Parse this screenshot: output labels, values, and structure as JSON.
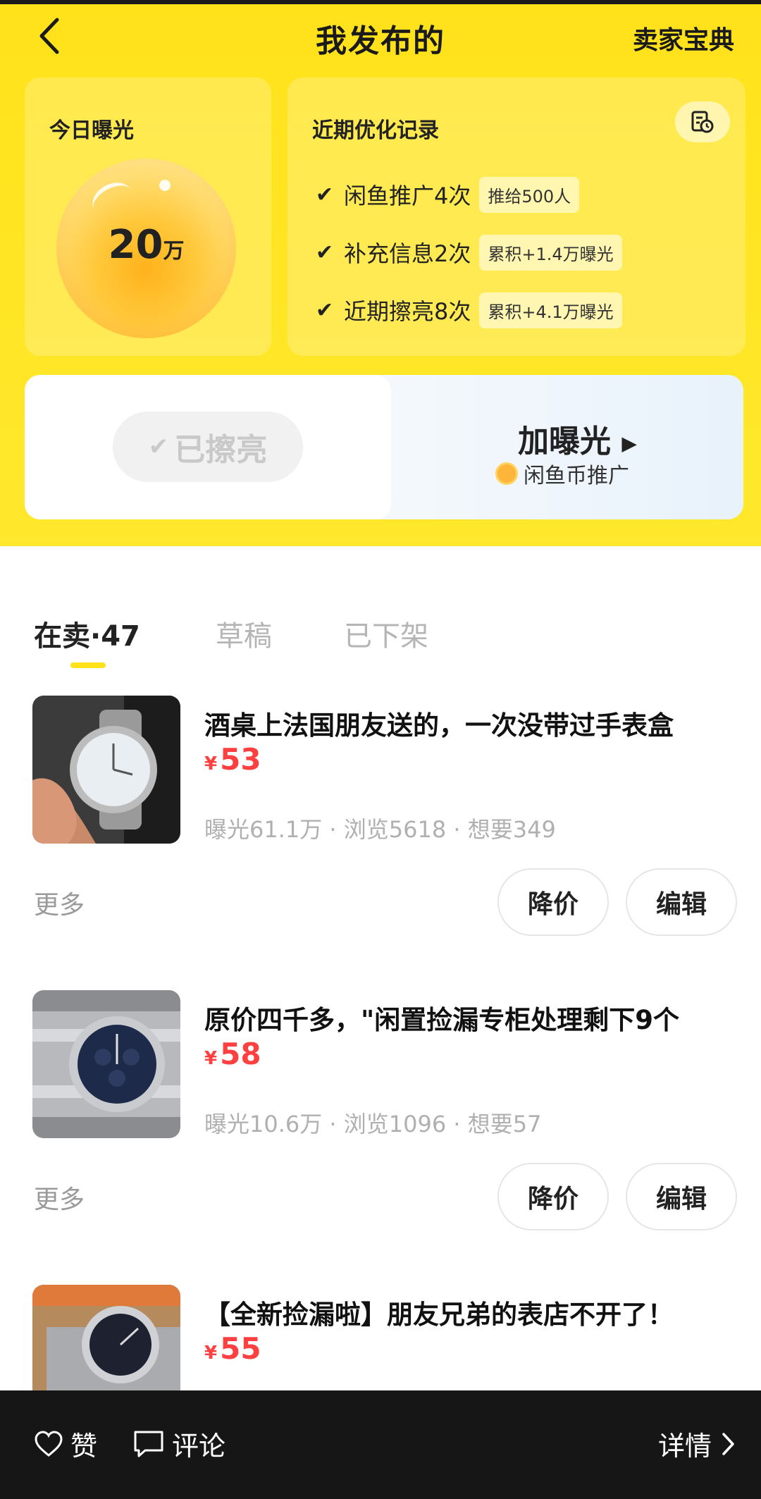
{
  "nav": {
    "title": "我发布的",
    "right_link": "卖家宝典"
  },
  "exposure": {
    "label": "今日曝光",
    "value": "20",
    "unit": "万"
  },
  "records": {
    "label": "近期优化记录",
    "items": [
      {
        "text": "闲鱼推广4次",
        "tag": "推给500人"
      },
      {
        "text": "补充信息2次",
        "tag": "累积+1.4万曝光"
      },
      {
        "text": "近期擦亮8次",
        "tag": "累积+4.1万曝光"
      }
    ]
  },
  "cta": {
    "polished_label": "已擦亮",
    "boost_title": "加曝光",
    "boost_sub": "闲鱼币推广"
  },
  "tabs": [
    {
      "label": "在卖·47"
    },
    {
      "label": "草稿"
    },
    {
      "label": "已下架"
    }
  ],
  "listings": [
    {
      "title": "酒桌上法国朋友送的，一次没带过手表盒",
      "currency": "¥",
      "price": "53",
      "stats": "曝光61.1万 · 浏览5618 · 想要349",
      "more_label": "更多",
      "price_cut_label": "降价",
      "edit_label": "编辑"
    },
    {
      "title": "原价四千多，\"闲置捡漏专柜处理剩下9个",
      "currency": "¥",
      "price": "58",
      "stats": "曝光10.6万 · 浏览1096 · 想要57",
      "more_label": "更多",
      "price_cut_label": "降价",
      "edit_label": "编辑"
    },
    {
      "title": "【全新捡漏啦】朋友兄弟的表店不开了！",
      "currency": "¥",
      "price": "55"
    }
  ],
  "bottom_bar": {
    "like_label": "赞",
    "comment_label": "评论",
    "detail_label": "详情"
  }
}
